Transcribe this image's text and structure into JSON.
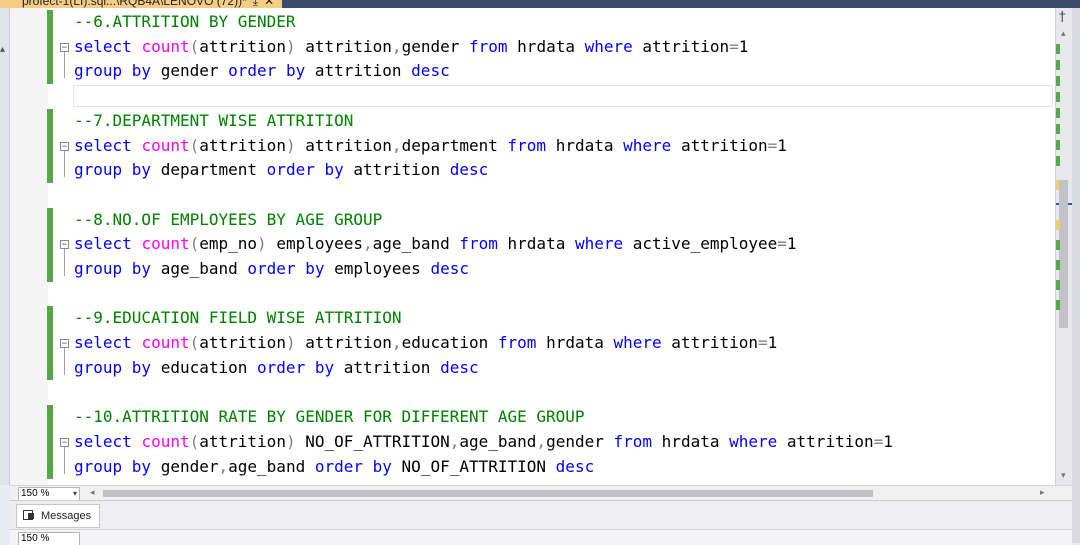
{
  "tab": {
    "title": "profect-1(LI).sql...\\RQB4A\\LENOVO (72))*",
    "pin": "⤓",
    "close": "✕"
  },
  "editor": {
    "lines": [
      [
        [
          "--6.ATTRITION BY GENDER",
          "cm"
        ]
      ],
      [
        [
          "select ",
          "kw"
        ],
        [
          "count",
          "fn"
        ],
        [
          "(",
          "gy"
        ],
        [
          "attrition",
          "t"
        ],
        [
          ")",
          "gy"
        ],
        [
          " attrition",
          "t"
        ],
        [
          ",",
          "gy"
        ],
        [
          "gender ",
          "t"
        ],
        [
          "from ",
          "kw"
        ],
        [
          "hrdata ",
          "t"
        ],
        [
          "where ",
          "kw"
        ],
        [
          "attrition",
          "t"
        ],
        [
          "=",
          "gy"
        ],
        [
          "1",
          "t"
        ]
      ],
      [
        [
          "group ",
          "kw"
        ],
        [
          "by ",
          "kw"
        ],
        [
          "gender ",
          "t"
        ],
        [
          "order ",
          "kw"
        ],
        [
          "by ",
          "kw"
        ],
        [
          "attrition ",
          "t"
        ],
        [
          "desc",
          "kw"
        ]
      ],
      [],
      [
        [
          "--7.DEPARTMENT WISE ATTRITION",
          "cm"
        ]
      ],
      [
        [
          "select ",
          "kw"
        ],
        [
          "count",
          "fn"
        ],
        [
          "(",
          "gy"
        ],
        [
          "attrition",
          "t"
        ],
        [
          ")",
          "gy"
        ],
        [
          " attrition",
          "t"
        ],
        [
          ",",
          "gy"
        ],
        [
          "department ",
          "t"
        ],
        [
          "from ",
          "kw"
        ],
        [
          "hrdata ",
          "t"
        ],
        [
          "where ",
          "kw"
        ],
        [
          "attrition",
          "t"
        ],
        [
          "=",
          "gy"
        ],
        [
          "1",
          "t"
        ]
      ],
      [
        [
          "group ",
          "kw"
        ],
        [
          "by ",
          "kw"
        ],
        [
          "department ",
          "t"
        ],
        [
          "order ",
          "kw"
        ],
        [
          "by ",
          "kw"
        ],
        [
          "attrition ",
          "t"
        ],
        [
          "desc",
          "kw"
        ]
      ],
      [],
      [
        [
          "--8.NO.OF EMPLOYEES BY AGE GROUP",
          "cm"
        ]
      ],
      [
        [
          "select ",
          "kw"
        ],
        [
          "count",
          "fn"
        ],
        [
          "(",
          "gy"
        ],
        [
          "emp_no",
          "t"
        ],
        [
          ")",
          "gy"
        ],
        [
          " employees",
          "t"
        ],
        [
          ",",
          "gy"
        ],
        [
          "age_band ",
          "t"
        ],
        [
          "from ",
          "kw"
        ],
        [
          "hrdata ",
          "t"
        ],
        [
          "where ",
          "kw"
        ],
        [
          "active_employee",
          "t"
        ],
        [
          "=",
          "gy"
        ],
        [
          "1",
          "t"
        ]
      ],
      [
        [
          "group ",
          "kw"
        ],
        [
          "by ",
          "kw"
        ],
        [
          "age_band ",
          "t"
        ],
        [
          "order ",
          "kw"
        ],
        [
          "by ",
          "kw"
        ],
        [
          "employees ",
          "t"
        ],
        [
          "desc",
          "kw"
        ]
      ],
      [],
      [
        [
          "--9.EDUCATION FIELD WISE ATTRITION",
          "cm"
        ]
      ],
      [
        [
          "select ",
          "kw"
        ],
        [
          "count",
          "fn"
        ],
        [
          "(",
          "gy"
        ],
        [
          "attrition",
          "t"
        ],
        [
          ")",
          "gy"
        ],
        [
          " attrition",
          "t"
        ],
        [
          ",",
          "gy"
        ],
        [
          "education ",
          "t"
        ],
        [
          "from ",
          "kw"
        ],
        [
          "hrdata ",
          "t"
        ],
        [
          "where ",
          "kw"
        ],
        [
          "attrition",
          "t"
        ],
        [
          "=",
          "gy"
        ],
        [
          "1",
          "t"
        ]
      ],
      [
        [
          "group ",
          "kw"
        ],
        [
          "by ",
          "kw"
        ],
        [
          "education ",
          "t"
        ],
        [
          "order ",
          "kw"
        ],
        [
          "by ",
          "kw"
        ],
        [
          "attrition ",
          "t"
        ],
        [
          "desc",
          "kw"
        ]
      ],
      [],
      [
        [
          "--10.ATTRITION RATE BY GENDER FOR DIFFERENT AGE GROUP",
          "cm"
        ]
      ],
      [
        [
          "select ",
          "kw"
        ],
        [
          "count",
          "fn"
        ],
        [
          "(",
          "gy"
        ],
        [
          "attrition",
          "t"
        ],
        [
          ")",
          "gy"
        ],
        [
          " NO_OF_ATTRITION",
          "t"
        ],
        [
          ",",
          "gy"
        ],
        [
          "age_band",
          "t"
        ],
        [
          ",",
          "gy"
        ],
        [
          "gender ",
          "t"
        ],
        [
          "from ",
          "kw"
        ],
        [
          "hrdata ",
          "t"
        ],
        [
          "where ",
          "kw"
        ],
        [
          "attrition",
          "t"
        ],
        [
          "=",
          "gy"
        ],
        [
          "1",
          "t"
        ]
      ],
      [
        [
          "group ",
          "kw"
        ],
        [
          "by ",
          "kw"
        ],
        [
          "gender",
          "t"
        ],
        [
          ",",
          "gy"
        ],
        [
          "age_band ",
          "t"
        ],
        [
          "order ",
          "kw"
        ],
        [
          "by ",
          "kw"
        ],
        [
          "NO_OF_ATTRITION ",
          "t"
        ],
        [
          "desc",
          "kw"
        ]
      ]
    ],
    "fold_markers": [
      "−",
      "−",
      "−",
      "−",
      "−"
    ]
  },
  "scrollbar": {
    "split": "†",
    "up": "▴",
    "down": "▾",
    "left": "◂",
    "right": "▸"
  },
  "zoom": {
    "value": "150 %",
    "dropdown": "▾"
  },
  "results": {
    "messages_tab": "Messages"
  },
  "bottom_zoom": {
    "value": "150 %"
  },
  "colors": {
    "keyword": "#0000ff",
    "function": "#ff00ff",
    "comment": "#008000",
    "operator": "#808080",
    "change_bar": "#57a64a",
    "tab": "#f5cc84"
  }
}
